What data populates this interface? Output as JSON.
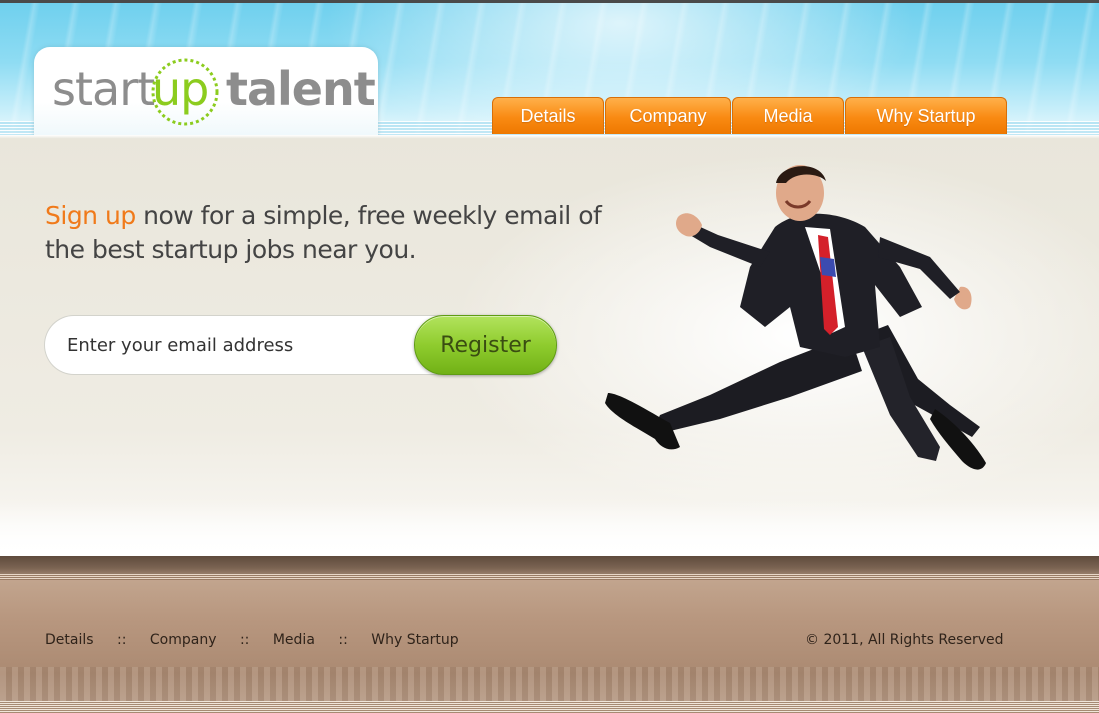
{
  "brand": {
    "logo_part1": "start",
    "logo_part2": "up",
    "logo_part3": "talent",
    "colors": {
      "orange": "#f07a1a",
      "green": "#8ccc1e",
      "sky": "#6fd0ee",
      "footer": "#b8977f"
    }
  },
  "nav": {
    "items": [
      {
        "label": "Details"
      },
      {
        "label": "Company"
      },
      {
        "label": "Media"
      },
      {
        "label": "Why Startup"
      }
    ]
  },
  "hero": {
    "headline_accent": "Sign up",
    "headline_rest": " now for a simple, free weekly email of the best startup jobs near you.",
    "email_placeholder": "Enter your email address",
    "register_label": "Register",
    "image": "jumping-businessman"
  },
  "footer": {
    "links": [
      {
        "label": "Details"
      },
      {
        "label": "Company"
      },
      {
        "label": "Media"
      },
      {
        "label": "Why Startup"
      }
    ],
    "separator": "::",
    "copyright": "© 2011, All Rights Reserved"
  }
}
